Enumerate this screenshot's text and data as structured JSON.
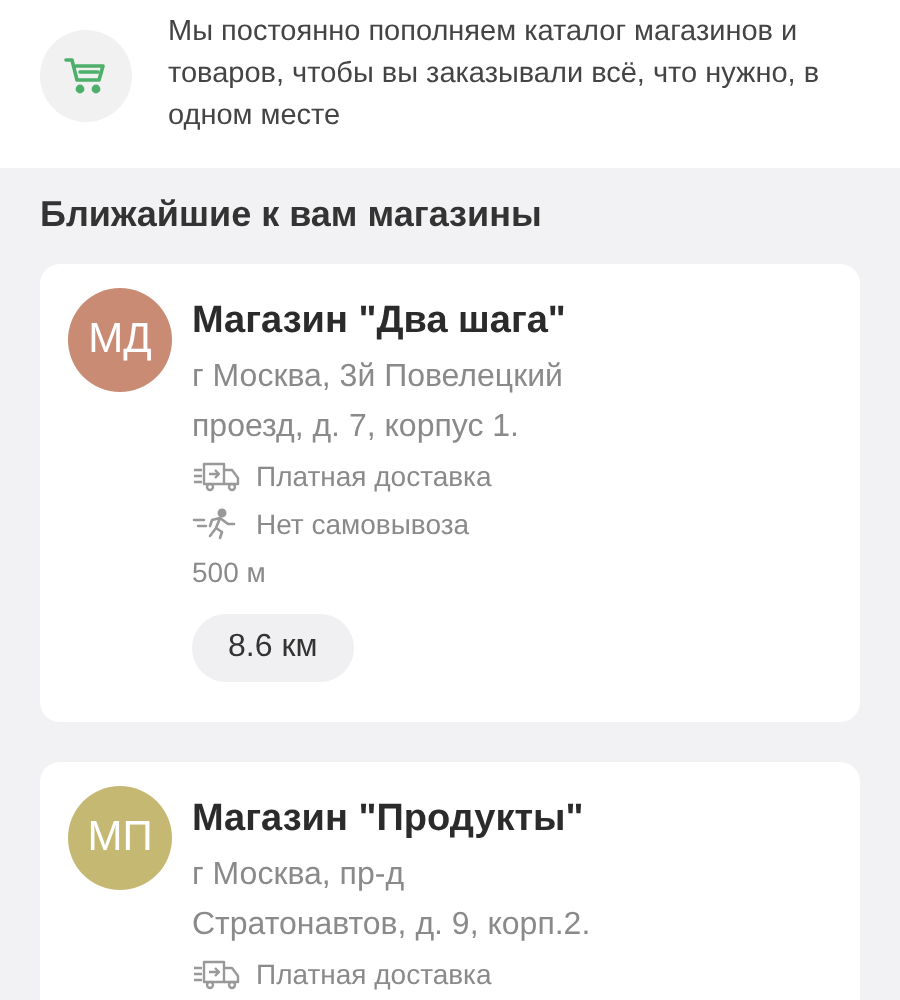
{
  "banner": {
    "text": "Мы постоянно пополняем каталог магазинов и товаров, чтобы вы заказывали всё, что нужно, в одном месте"
  },
  "section_title": "Ближайшие к вам магазины",
  "stores": [
    {
      "initials": "МД",
      "color": "#c98b74",
      "name": "Магазин \"Два шага\"",
      "address_lines": [
        "г Москва, 3й Повелецкий",
        "проезд, д. 7, корпус 1."
      ],
      "features": [
        {
          "kind": "delivery",
          "text": "Платная доставка"
        },
        {
          "kind": "pickup",
          "text": "Нет самовывоза"
        }
      ],
      "distance": "500 м",
      "chip": "8.6 км"
    },
    {
      "initials": "МП",
      "color": "#c5b872",
      "name": "Магазин \"Продукты\"",
      "address_lines": [
        "г Москва, пр-д",
        "Стратонавтов, д. 9, корп.2."
      ],
      "features": [
        {
          "kind": "delivery",
          "text": "Платная доставка"
        }
      ]
    }
  ]
}
